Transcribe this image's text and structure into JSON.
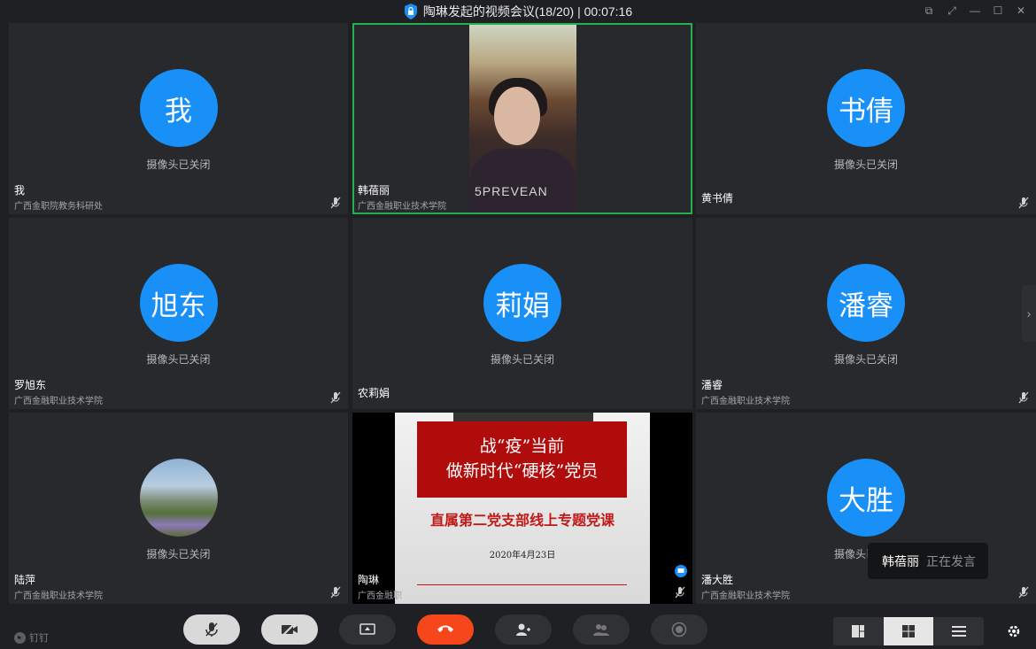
{
  "window": {
    "title": "陶琳发起的视频会议(18/20) | 00:07:16"
  },
  "participants": [
    {
      "avatar_text": "我",
      "name": "我",
      "org": "广西金职院教务科研处",
      "camera_status": "摄像头已关闭"
    },
    {
      "avatar_text": "",
      "name": "韩蓓丽",
      "org": "广西金融职业技术学院",
      "camera_status": "",
      "shirt_text": "5PREVEAN"
    },
    {
      "avatar_text": "书倩",
      "name": "黄书倩",
      "org": "",
      "camera_status": "摄像头已关闭"
    },
    {
      "avatar_text": "旭东",
      "name": "罗旭东",
      "org": "广西金融职业技术学院",
      "camera_status": "摄像头已关闭"
    },
    {
      "avatar_text": "莉娟",
      "name": "农莉娟",
      "org": "",
      "camera_status": "摄像头已关闭"
    },
    {
      "avatar_text": "潘睿",
      "name": "潘睿",
      "org": "广西金融职业技术学院",
      "camera_status": "摄像头已关闭"
    },
    {
      "avatar_text": "",
      "name": "陆萍",
      "org": "广西金融职业技术学院",
      "camera_status": "摄像头已关闭"
    },
    {
      "avatar_text": "",
      "name": "陶琳",
      "org": "广西金融职",
      "camera_status": ""
    },
    {
      "avatar_text": "大胜",
      "name": "潘大胜",
      "org": "广西金融职业技术学院",
      "camera_status": "摄像头已关闭"
    }
  ],
  "slide": {
    "line1": "战“疫”当前",
    "line2": "做新时代“硬核”党员",
    "subtitle": "直属第二党支部线上专题党课",
    "date": "2020年4月23日"
  },
  "speaking_toast": {
    "name": "韩蓓丽",
    "status": "正在发言"
  },
  "bottombar": {
    "brand": "钉钉"
  },
  "colors": {
    "avatar_blue": "#1890f7",
    "active_green": "#23b04d",
    "hangup_red": "#f5471b"
  },
  "icons": [
    "lock-icon",
    "mic-off-icon",
    "camera-off-icon",
    "screen-share-icon",
    "hangup-icon",
    "add-member-icon",
    "members-icon",
    "record-icon",
    "layout-speaker-icon",
    "layout-grid-icon",
    "layout-list-icon",
    "gear-icon",
    "chevron-right-icon"
  ]
}
